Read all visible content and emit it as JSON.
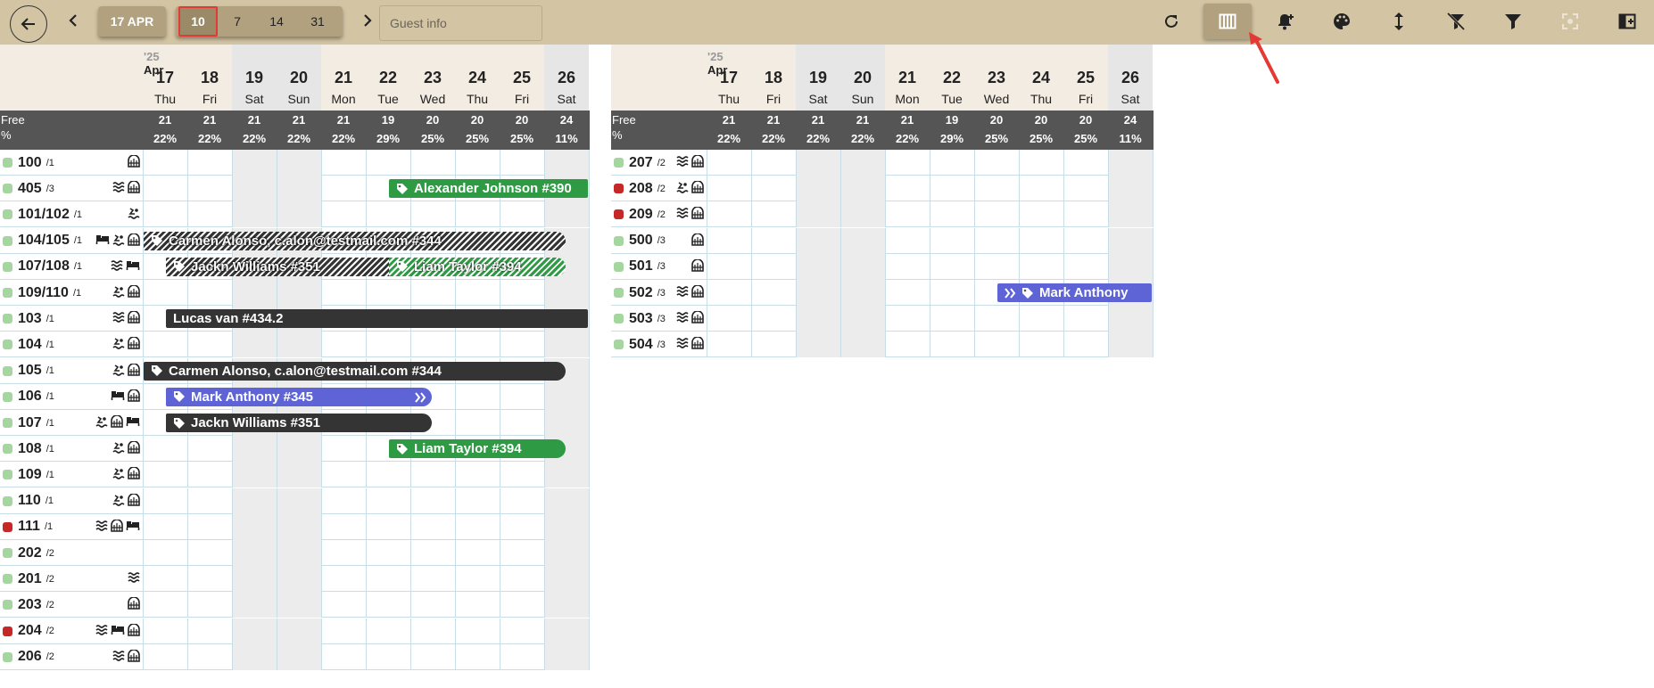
{
  "toolbar": {
    "current_date": "17 APR",
    "ranges": [
      "10",
      "7",
      "14",
      "31"
    ],
    "selected_range": "10",
    "guest_placeholder": "Guest info",
    "tools": [
      "refresh-icon",
      "columns-icon",
      "add-alert-icon",
      "palette-icon",
      "vertical-resize-icon",
      "clear-filter-icon",
      "filter-icon",
      "focus-frame-icon",
      "sidebar-toggle-icon"
    ],
    "active_tool": "columns-icon"
  },
  "calendar": {
    "year_label": "'25",
    "month_label": "Apr",
    "free_label": "Free",
    "percent_label": "%",
    "days": [
      {
        "num": "17",
        "name": "Thu",
        "free": "21",
        "pct": "22%",
        "weekend": false
      },
      {
        "num": "18",
        "name": "Fri",
        "free": "21",
        "pct": "22%",
        "weekend": false
      },
      {
        "num": "19",
        "name": "Sat",
        "free": "21",
        "pct": "22%",
        "weekend": true
      },
      {
        "num": "20",
        "name": "Sun",
        "free": "21",
        "pct": "22%",
        "weekend": true
      },
      {
        "num": "21",
        "name": "Mon",
        "free": "21",
        "pct": "22%",
        "weekend": false
      },
      {
        "num": "22",
        "name": "Tue",
        "free": "19",
        "pct": "29%",
        "weekend": false
      },
      {
        "num": "23",
        "name": "Wed",
        "free": "20",
        "pct": "25%",
        "weekend": false
      },
      {
        "num": "24",
        "name": "Thu",
        "free": "20",
        "pct": "25%",
        "weekend": false
      },
      {
        "num": "25",
        "name": "Fri",
        "free": "20",
        "pct": "25%",
        "weekend": false
      },
      {
        "num": "26",
        "name": "Sat",
        "free": "24",
        "pct": "11%",
        "weekend": true
      }
    ]
  },
  "status_colors": {
    "clean": "#a6d6a0",
    "dirty": "#c62828"
  },
  "left_rooms": [
    {
      "num": "100",
      "cap": "/1",
      "status": "clean",
      "icons": [
        "locker"
      ]
    },
    {
      "num": "405",
      "cap": "/3",
      "status": "clean",
      "icons": [
        "waves",
        "locker"
      ]
    },
    {
      "num": "101/102",
      "cap": "/1",
      "status": "clean",
      "icons": [
        "pool"
      ]
    },
    {
      "num": "104/105",
      "cap": "/1",
      "status": "clean",
      "icons": [
        "bed",
        "pool",
        "locker"
      ]
    },
    {
      "num": "107/108",
      "cap": "/1",
      "status": "clean",
      "icons": [
        "waves",
        "bed"
      ]
    },
    {
      "num": "109/110",
      "cap": "/1",
      "status": "clean",
      "icons": [
        "pool",
        "locker"
      ]
    },
    {
      "num": "103",
      "cap": "/1",
      "status": "clean",
      "icons": [
        "waves",
        "locker"
      ]
    },
    {
      "num": "104",
      "cap": "/1",
      "status": "clean",
      "icons": [
        "pool",
        "locker"
      ]
    },
    {
      "num": "105",
      "cap": "/1",
      "status": "clean",
      "icons": [
        "pool",
        "locker"
      ]
    },
    {
      "num": "106",
      "cap": "/1",
      "status": "clean",
      "icons": [
        "bed",
        "locker"
      ]
    },
    {
      "num": "107",
      "cap": "/1",
      "status": "clean",
      "icons": [
        "pool",
        "locker",
        "bed"
      ]
    },
    {
      "num": "108",
      "cap": "/1",
      "status": "clean",
      "icons": [
        "pool",
        "locker"
      ]
    },
    {
      "num": "109",
      "cap": "/1",
      "status": "clean",
      "icons": [
        "pool",
        "locker"
      ]
    },
    {
      "num": "110",
      "cap": "/1",
      "status": "clean",
      "icons": [
        "pool",
        "locker"
      ]
    },
    {
      "num": "111",
      "cap": "/1",
      "status": "dirty",
      "icons": [
        "waves",
        "locker",
        "bed"
      ]
    },
    {
      "num": "202",
      "cap": "/2",
      "status": "clean",
      "icons": []
    },
    {
      "num": "201",
      "cap": "/2",
      "status": "clean",
      "icons": [
        "waves"
      ]
    },
    {
      "num": "203",
      "cap": "/2",
      "status": "clean",
      "icons": [
        "locker"
      ]
    },
    {
      "num": "204",
      "cap": "/2",
      "status": "dirty",
      "icons": [
        "waves",
        "bed",
        "locker"
      ]
    },
    {
      "num": "206",
      "cap": "/2",
      "status": "clean",
      "icons": [
        "waves",
        "locker"
      ]
    }
  ],
  "right_rooms": [
    {
      "num": "207",
      "cap": "/2",
      "status": "clean",
      "icons": [
        "waves",
        "locker"
      ]
    },
    {
      "num": "208",
      "cap": "/2",
      "status": "dirty",
      "icons": [
        "pool",
        "locker"
      ]
    },
    {
      "num": "209",
      "cap": "/2",
      "status": "dirty",
      "icons": [
        "waves",
        "locker"
      ]
    },
    {
      "num": "500",
      "cap": "/3",
      "status": "clean",
      "icons": [
        "locker"
      ]
    },
    {
      "num": "501",
      "cap": "/3",
      "status": "clean",
      "icons": [
        "locker"
      ]
    },
    {
      "num": "502",
      "cap": "/3",
      "status": "clean",
      "icons": [
        "waves",
        "locker"
      ]
    },
    {
      "num": "503",
      "cap": "/3",
      "status": "clean",
      "icons": [
        "waves",
        "locker"
      ]
    },
    {
      "num": "504",
      "cap": "/3",
      "status": "clean",
      "icons": [
        "waves",
        "locker"
      ]
    }
  ],
  "bookings": [
    {
      "pane": "left",
      "row": 1,
      "start": 5.5,
      "end": 10,
      "label": "Alexander Johnson #390",
      "style": "green",
      "tag": true,
      "cont_in": false,
      "cont_out": true
    },
    {
      "pane": "left",
      "row": 3,
      "start": 0,
      "end": 9.5,
      "label": "Carmen Alonso, c.alon@testmail.com #344",
      "style": "hatch",
      "tag": true,
      "cont_in": true,
      "cont_out": false
    },
    {
      "pane": "left",
      "row": 4,
      "start": 0.5,
      "end": 6.5,
      "label": "Jackn Williams #351",
      "style": "hatch",
      "tag": true,
      "cont_in": false,
      "cont_out": false
    },
    {
      "pane": "left",
      "row": 4,
      "start": 5.5,
      "end": 9.5,
      "label": "Liam Taylor #394",
      "style": "hatchg",
      "tag": true,
      "cont_in": false,
      "cont_out": false
    },
    {
      "pane": "left",
      "row": 6,
      "start": 0.5,
      "end": 10,
      "label": "Lucas van #434.2",
      "style": "dark",
      "tag": false,
      "cont_in": false,
      "cont_out": true
    },
    {
      "pane": "left",
      "row": 8,
      "start": 0,
      "end": 9.5,
      "label": "Carmen Alonso, c.alon@testmail.com #344",
      "style": "dark",
      "tag": true,
      "cont_in": true,
      "cont_out": false
    },
    {
      "pane": "left",
      "row": 9,
      "start": 0.5,
      "end": 6.5,
      "label": "Mark Anthony #345",
      "style": "blue",
      "tag": true,
      "cont_in": false,
      "cont_out": false,
      "arrow_out": true
    },
    {
      "pane": "left",
      "row": 10,
      "start": 0.5,
      "end": 6.5,
      "label": "Jackn Williams #351",
      "style": "dark",
      "tag": true,
      "cont_in": false,
      "cont_out": false
    },
    {
      "pane": "left",
      "row": 11,
      "start": 5.5,
      "end": 9.5,
      "label": "Liam Taylor #394",
      "style": "green",
      "tag": true,
      "cont_in": false,
      "cont_out": false
    },
    {
      "pane": "right",
      "row": 5,
      "start": 6.5,
      "end": 10,
      "label": "Mark Anthony",
      "style": "blue",
      "tag": true,
      "cont_in": false,
      "cont_out": true,
      "arrow_in": true
    }
  ]
}
